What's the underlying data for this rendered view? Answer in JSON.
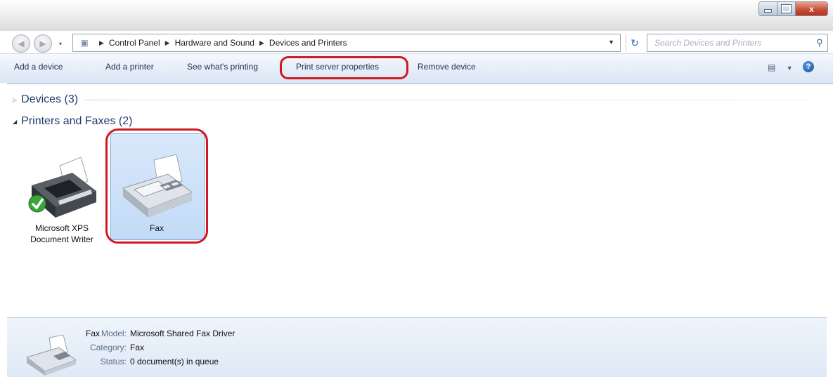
{
  "window": {
    "caption_buttons": [
      "minimize",
      "maximize",
      "close"
    ],
    "close_glyph": "x"
  },
  "nav": {
    "back_glyph": "◀",
    "forward_glyph": "▶",
    "breadcrumb": [
      "Control Panel",
      "Hardware and Sound",
      "Devices and Printers"
    ],
    "refresh_glyph": "↻",
    "search_placeholder": "Search Devices and Printers"
  },
  "toolbar": {
    "add_device": "Add a device",
    "add_printer": "Add a printer",
    "see_printing": "See what's printing",
    "print_server": "Print server properties",
    "remove_device": "Remove device",
    "help_glyph": "?"
  },
  "groups": {
    "devices": "Devices (3)",
    "printers": "Printers and Faxes (2)"
  },
  "printers": [
    {
      "name_line1": "Microsoft XPS",
      "name_line2": "Document Writer"
    },
    {
      "name_line1": "Fax"
    }
  ],
  "details": {
    "name": "Fax",
    "model_label": "Model:",
    "model_value": "Microsoft Shared Fax Driver",
    "category_label": "Category:",
    "category_value": "Fax",
    "status_label": "Status:",
    "status_value": "0 document(s) in queue"
  },
  "colors": {
    "highlight": "#d01a22",
    "selection": "#c3dbf7",
    "link_text": "#1e3b6a"
  }
}
